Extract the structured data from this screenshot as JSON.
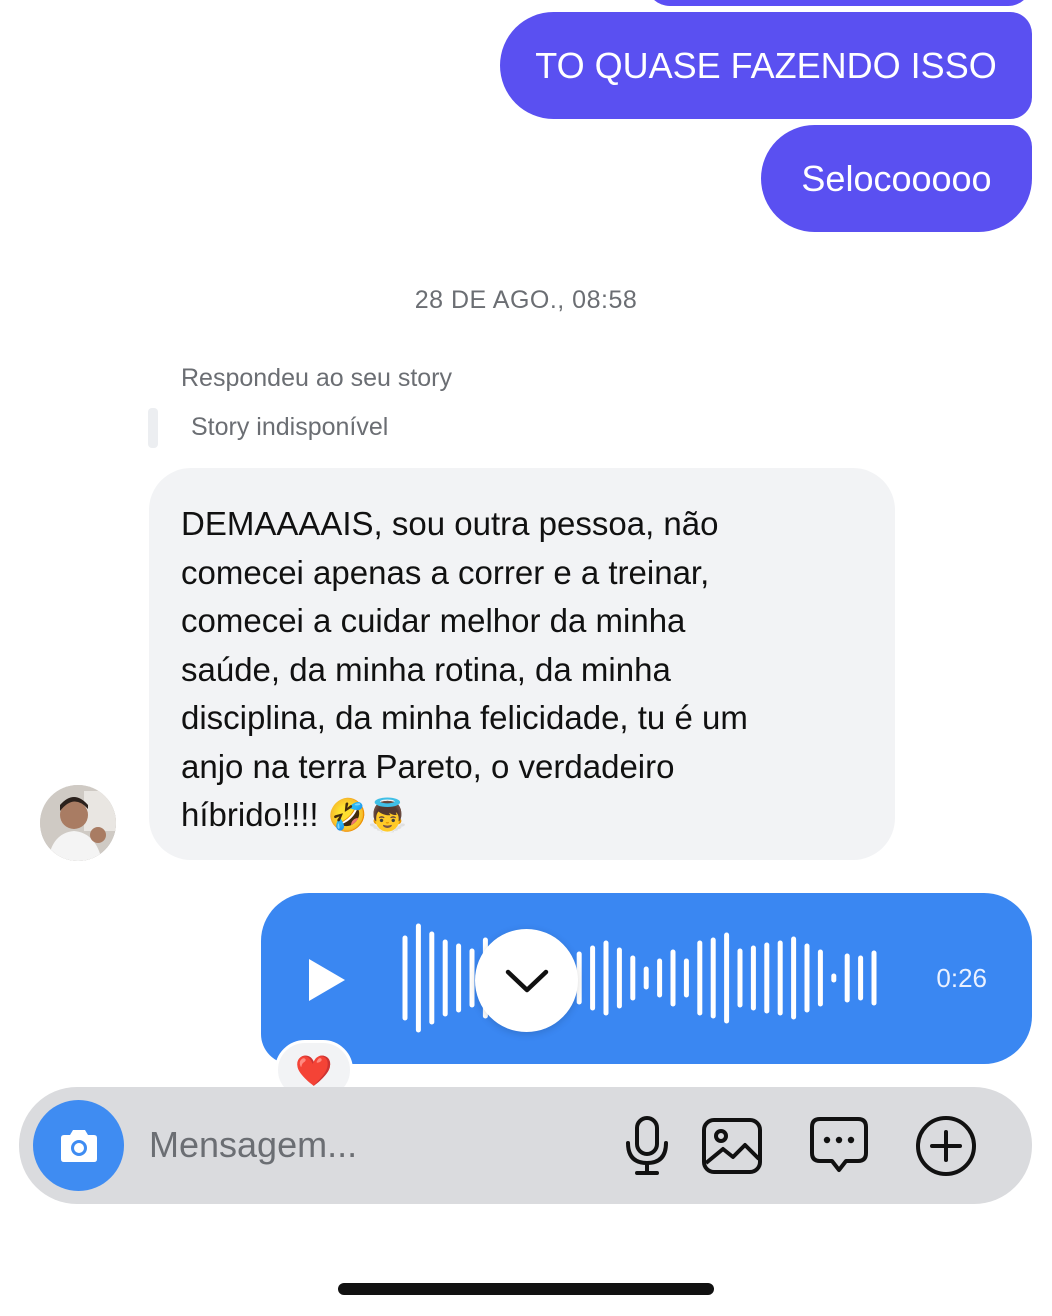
{
  "messages": {
    "sent_1": "TO QUASE FAZENDO ISSO",
    "sent_2": "Selocooooo",
    "timestamp": "28 DE AGO., 08:58",
    "reply_label": "Respondeu ao seu story",
    "story_status": "Story indisponível",
    "incoming_lines": [
      "DEMAAAAIS, sou outra pessoa, não",
      "comecei apenas a correr e a treinar,",
      "comecei a cuidar melhor da minha",
      "saúde, da minha rotina, da minha",
      "disciplina, da minha felicidade, tu é um",
      "anjo na terra Pareto, o verdadeiro",
      "híbrido!!!!"
    ],
    "incoming_emojis": "🤣👼",
    "voice_duration": "0:26",
    "reaction": "❤️"
  },
  "composer": {
    "placeholder": "Mensagem..."
  },
  "icons": {
    "camera": "camera-icon",
    "mic": "microphone-icon",
    "gallery": "image-icon",
    "sticker": "chat-bubble-icon",
    "add": "plus-circle-icon",
    "play": "play-icon",
    "scroll": "chevron-down-icon"
  },
  "colors": {
    "outgoing": "#5a50f1",
    "voice": "#3a87f2",
    "incoming": "#f2f3f5",
    "accent": "#3f8cf2"
  }
}
